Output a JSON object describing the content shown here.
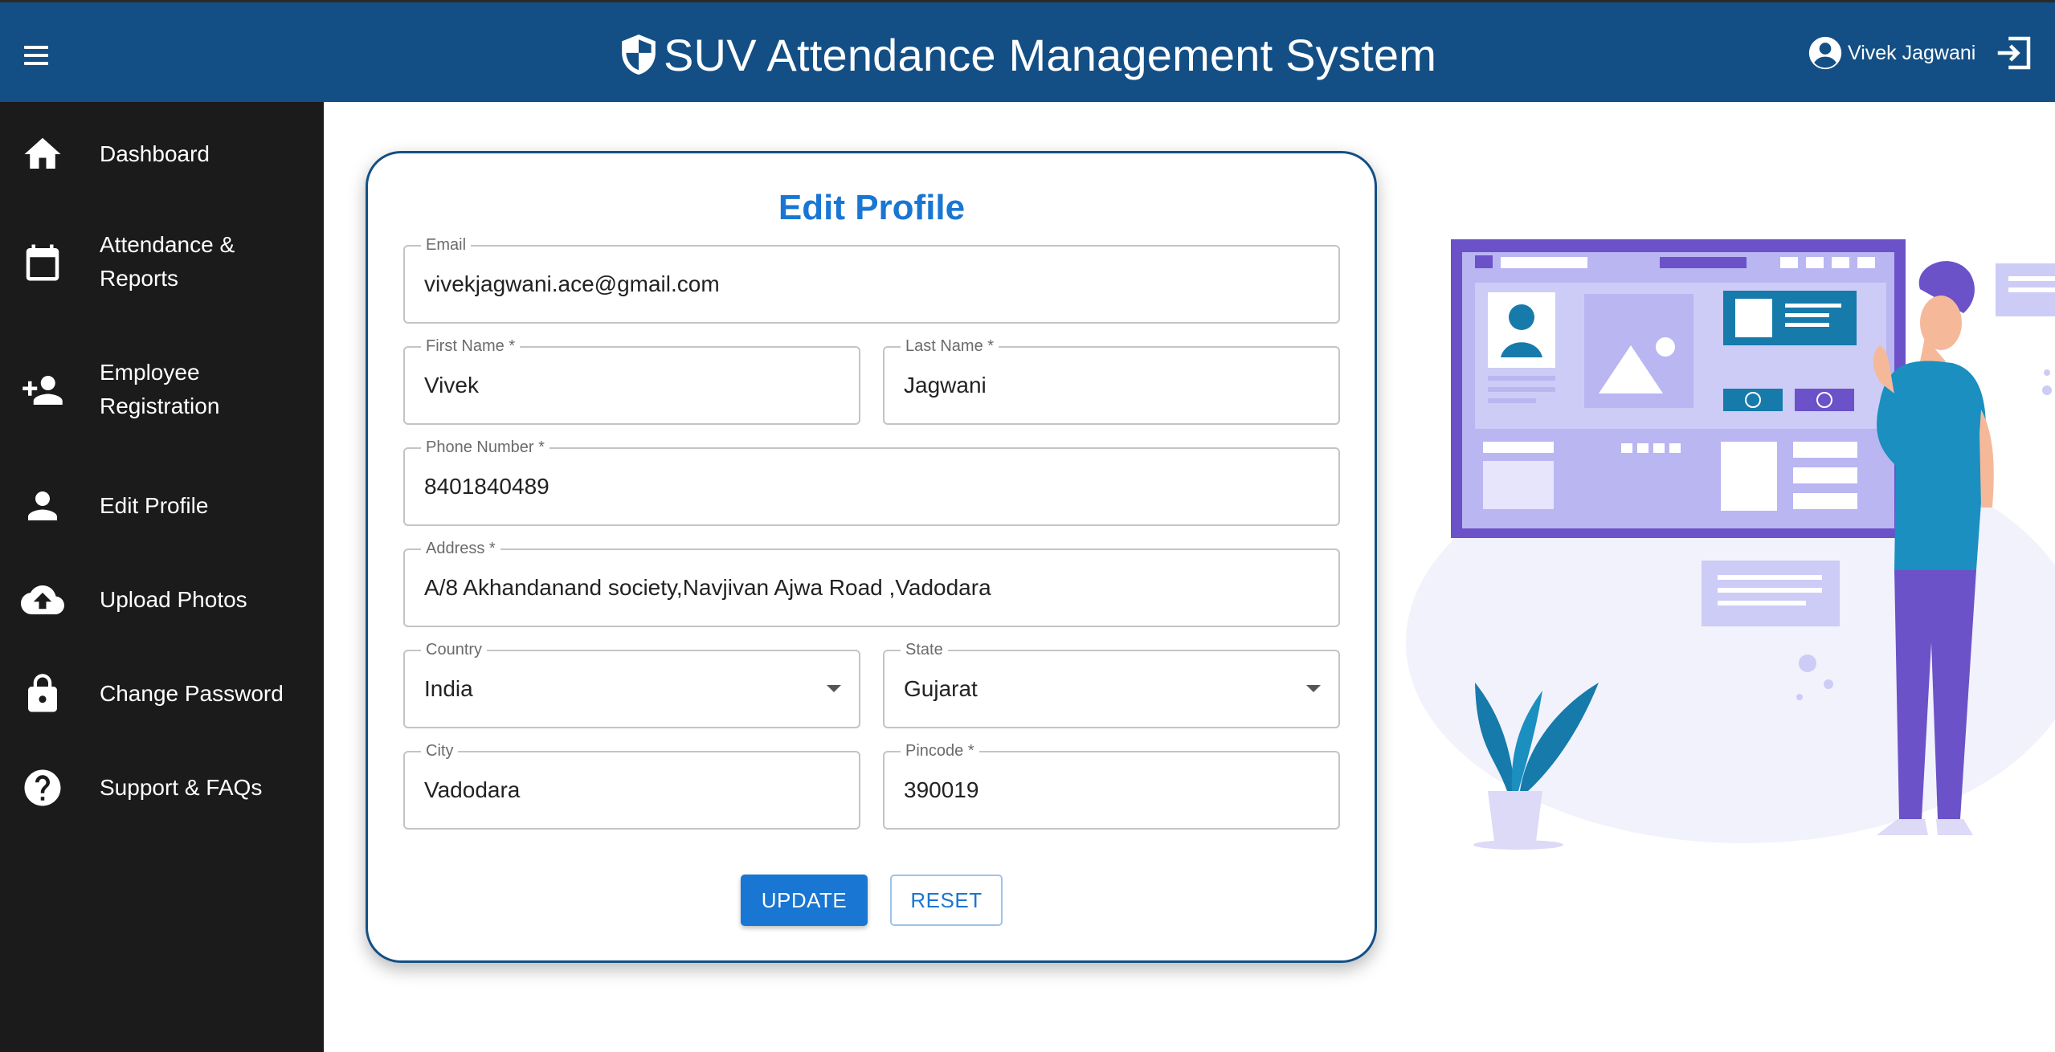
{
  "header": {
    "title": "SUV Attendance Management System",
    "user_name": "Vivek Jagwani",
    "brand_color": "#134f85",
    "menu_icon": "hamburger-menu-icon",
    "brand_icon": "shield-icon",
    "user_icon": "account-circle-icon",
    "logout_icon": "logout-icon"
  },
  "sidebar": {
    "background": "#1b1b1b",
    "items": [
      {
        "label": "Dashboard",
        "icon": "home-icon"
      },
      {
        "label": "Attendance & Reports",
        "icon": "calendar-icon"
      },
      {
        "label": "Employee Registration",
        "icon": "person-add-icon"
      },
      {
        "label": "Edit Profile",
        "icon": "person-icon"
      },
      {
        "label": "Upload Photos",
        "icon": "cloud-upload-icon"
      },
      {
        "label": "Change Password",
        "icon": "lock-icon"
      },
      {
        "label": "Support & FAQs",
        "icon": "help-icon"
      }
    ]
  },
  "form": {
    "title": "Edit Profile",
    "accent": "#1976d2",
    "email": {
      "label": "Email",
      "value": "vivekjagwani.ace@gmail.com"
    },
    "first_name": {
      "label": "First Name *",
      "value": "Vivek"
    },
    "last_name": {
      "label": "Last Name *",
      "value": "Jagwani"
    },
    "phone": {
      "label": "Phone Number *",
      "value": "8401840489"
    },
    "address": {
      "label": "Address *",
      "value": "A/8 Akhandanand society,Navjivan Ajwa Road ,Vadodara"
    },
    "country": {
      "label": "Country",
      "value": "India"
    },
    "state": {
      "label": "State",
      "value": "Gujarat"
    },
    "city": {
      "label": "City",
      "value": "Vadodara"
    },
    "pincode": {
      "label": "Pincode *",
      "value": "390019"
    },
    "update_label": "UPDATE",
    "reset_label": "RESET"
  }
}
